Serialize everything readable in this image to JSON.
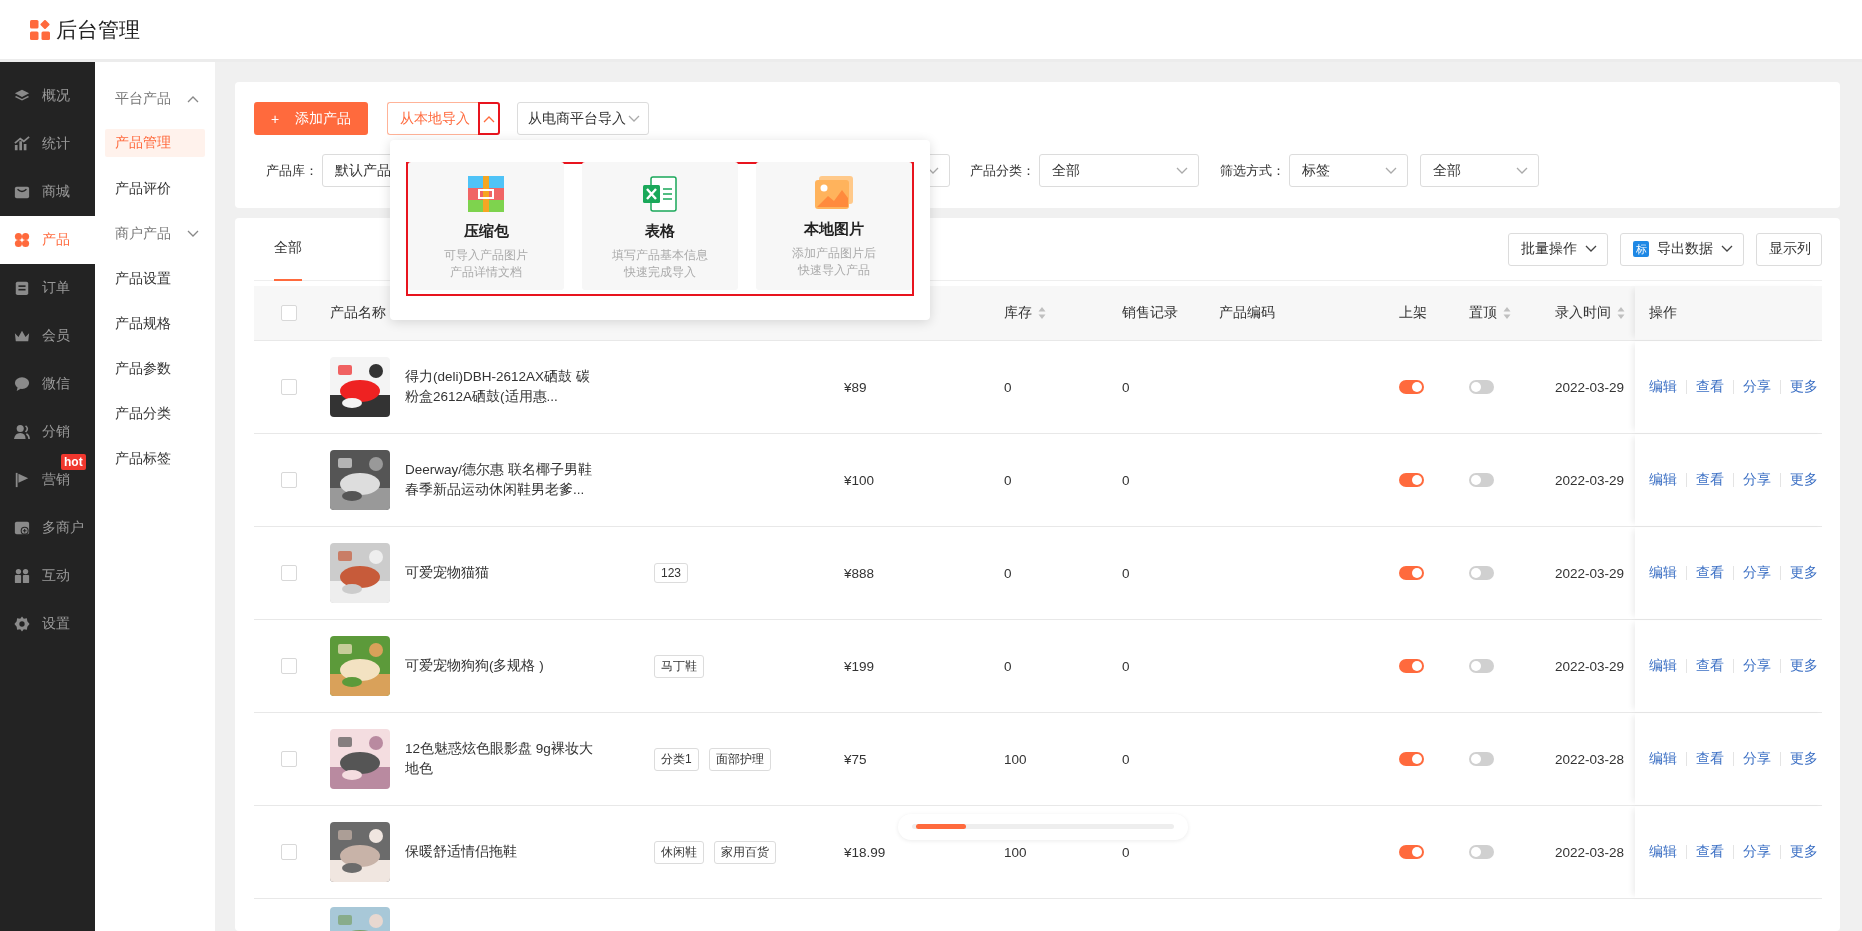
{
  "app": {
    "title": "后台管理"
  },
  "nav": [
    {
      "label": "概况",
      "selected": false
    },
    {
      "label": "统计",
      "selected": false
    },
    {
      "label": "商城",
      "selected": false
    },
    {
      "label": "产品",
      "selected": true
    },
    {
      "label": "订单",
      "selected": false
    },
    {
      "label": "会员",
      "selected": false
    },
    {
      "label": "微信",
      "selected": false
    },
    {
      "label": "分销",
      "selected": false
    },
    {
      "label": "营销",
      "selected": false,
      "badge": "hot"
    },
    {
      "label": "多商户",
      "selected": false
    },
    {
      "label": "互动",
      "selected": false
    },
    {
      "label": "设置",
      "selected": false
    }
  ],
  "subnav": [
    {
      "label": "平台产品",
      "kind": "group",
      "expanded": true
    },
    {
      "label": "产品管理",
      "kind": "item",
      "selected": true
    },
    {
      "label": "产品评价",
      "kind": "item",
      "selected": false
    },
    {
      "label": "商户产品",
      "kind": "group",
      "expanded": false
    },
    {
      "label": "产品设置",
      "kind": "item",
      "selected": false
    },
    {
      "label": "产品规格",
      "kind": "item",
      "selected": false
    },
    {
      "label": "产品参数",
      "kind": "item",
      "selected": false
    },
    {
      "label": "产品分类",
      "kind": "item",
      "selected": false
    },
    {
      "label": "产品标签",
      "kind": "item",
      "selected": false
    }
  ],
  "toolbar": {
    "add_button": {
      "icon": "+",
      "label": "添加产品"
    },
    "import_local": {
      "label": "从本地导入",
      "expanded": true,
      "highlighted": true
    },
    "import_platform": {
      "label": "从电商平台导入"
    }
  },
  "filters": [
    {
      "label": "产品库：",
      "value": "默认产品"
    },
    {
      "label": "产品分类：",
      "value": "全部"
    },
    {
      "label": "筛选方式：",
      "value": "标签"
    },
    {
      "value": "全部"
    }
  ],
  "import_menu": {
    "highlighted": true,
    "options": [
      {
        "title": "压缩包",
        "lines": [
          "可导入产品图片",
          "产品详情文档"
        ]
      },
      {
        "title": "表格",
        "lines": [
          "填写产品基本信息",
          "快速完成导入"
        ]
      },
      {
        "title": "本地图片",
        "lines": [
          "添加产品图片后",
          "快速导入产品"
        ]
      }
    ]
  },
  "tabs": [
    {
      "label": "全部",
      "selected": true
    }
  ],
  "actions": [
    {
      "kind": "menu",
      "label": "批量操作"
    },
    {
      "kind": "export",
      "icon_text": "标",
      "label": "导出数据"
    },
    {
      "kind": "plain",
      "label": "显示列"
    }
  ],
  "table": {
    "header_checked": false,
    "columns": [
      {
        "label": "产品名称"
      },
      {
        "label": "库存",
        "sortable": true
      },
      {
        "label": "销售记录",
        "sortable": false
      },
      {
        "label": "产品编码",
        "sortable": false
      },
      {
        "label": "上架",
        "sortable": false
      },
      {
        "label": "置顶",
        "sortable": true
      },
      {
        "label": "录入时间",
        "sortable": true
      },
      {
        "label": "操作",
        "sortable": false
      }
    ],
    "rows": [
      {
        "kind": "full",
        "checked": false,
        "name": "得力(deli)DBH-2612AX硒鼓 碳粉盒2612A硒鼓(适用惠...",
        "tags": [],
        "price": "¥89",
        "stock": "0",
        "sales": "0",
        "listed": true,
        "pinned": false,
        "date": "2022-03-29",
        "ops": [
          "编辑",
          "查看",
          "分享",
          "更多"
        ]
      },
      {
        "kind": "full",
        "checked": false,
        "name": "Deerway/德尔惠 联名椰子男鞋春季新品运动休闲鞋男老爹...",
        "tags": [],
        "price": "¥100",
        "stock": "0",
        "sales": "0",
        "listed": true,
        "pinned": false,
        "date": "2022-03-29",
        "ops": [
          "编辑",
          "查看",
          "分享",
          "更多"
        ]
      },
      {
        "kind": "full",
        "checked": false,
        "name": "可爱宠物猫猫",
        "tags": [
          "123"
        ],
        "price": "¥888",
        "stock": "0",
        "sales": "0",
        "listed": true,
        "pinned": false,
        "date": "2022-03-29",
        "ops": [
          "编辑",
          "查看",
          "分享",
          "更多"
        ]
      },
      {
        "kind": "full",
        "checked": false,
        "name": "可爱宠物狗狗(多规格 )",
        "tags": [
          "马丁鞋"
        ],
        "price": "¥199",
        "stock": "0",
        "sales": "0",
        "listed": true,
        "pinned": false,
        "date": "2022-03-29",
        "ops": [
          "编辑",
          "查看",
          "分享",
          "更多"
        ]
      },
      {
        "kind": "full",
        "checked": false,
        "name": "12色魅惑炫色眼影盘 9g裸妆大地色",
        "tags": [
          "分类1",
          "面部护理"
        ],
        "price": "¥75",
        "stock": "100",
        "sales": "0",
        "listed": true,
        "pinned": false,
        "date": "2022-03-28",
        "ops": [
          "编辑",
          "查看",
          "分享",
          "更多"
        ]
      },
      {
        "kind": "full",
        "checked": false,
        "name": "保暖舒适情侣拖鞋",
        "tags": [
          "休闲鞋",
          "家用百货"
        ],
        "price": "¥18.99",
        "stock": "100",
        "sales": "0",
        "listed": true,
        "pinned": false,
        "date": "2022-03-28",
        "ops": [
          "编辑",
          "查看",
          "分享",
          "更多"
        ]
      },
      {
        "kind": "cut"
      }
    ]
  }
}
